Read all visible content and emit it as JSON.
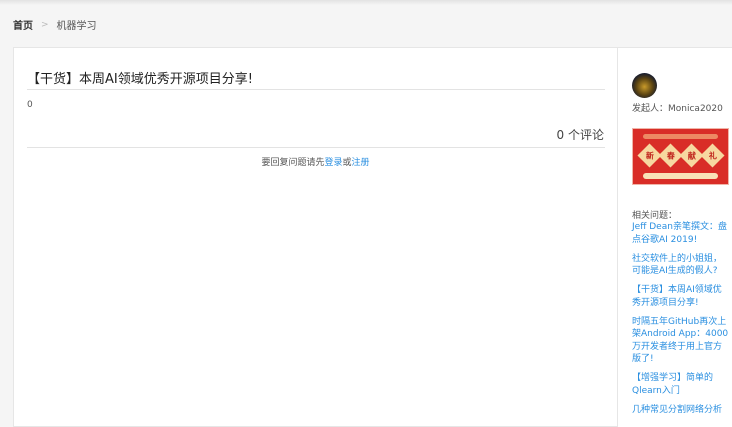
{
  "breadcrumb": {
    "home": "首页",
    "separator": ">",
    "current": "机器学习"
  },
  "question": {
    "title": "【干货】本周AI领域优秀开源项目分享!",
    "body": "0",
    "comment_count": "0 个评论"
  },
  "reply": {
    "prefix": "要回复问题请先",
    "login": "登录",
    "or": "或",
    "register": "注册"
  },
  "sidebar": {
    "starter": "发起人：Monica2020",
    "banner_chars": [
      "新",
      "春",
      "献",
      "礼"
    ],
    "related_heading": "相关问题：",
    "related": [
      "Jeff Dean亲笔撰文：盘点谷歌AI 2019!",
      "社交软件上的小姐姐，可能是AI生成的假人?",
      "【干货】本周AI领域优秀开源项目分享!",
      "时隔五年GitHub再次上架Android App：4000万开发者终于用上官方版了!",
      "【增强学习】简单的Qlearn入门",
      "几种常见分割网络分析"
    ]
  }
}
